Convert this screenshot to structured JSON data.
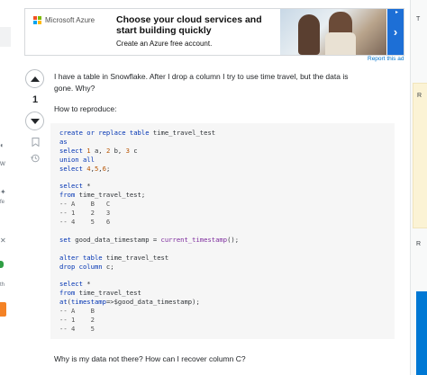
{
  "ad": {
    "brand": "Microsoft Azure",
    "headline": "Choose your cloud services and start building quickly",
    "subtext": "Create an Azure free account.",
    "report": "Report this ad"
  },
  "question": {
    "score": "1",
    "body_intro": "I have a table in Snowflake. After I drop a column I try to use time travel, but the data is gone. Why?",
    "how_to": "How to reproduce:",
    "closing": "Why is my data not there? How can I recover column C?"
  },
  "colors": {
    "accent": "#0074cc",
    "azure_blue": "#1d6fd6",
    "code_bg": "#f6f6f6",
    "keyword": "#0033b3",
    "number": "#b75301"
  },
  "icons": {
    "upvote": "caret-up-icon",
    "downvote": "caret-down-icon",
    "bookmark": "bookmark-icon",
    "history": "history-icon",
    "ad_next": "chevron-right-icon"
  },
  "sidebar_right": {
    "labels": [
      "T",
      "R",
      "R"
    ]
  },
  "sidebar_left": {
    "labels": [
      "w",
      "fe",
      "th"
    ]
  }
}
